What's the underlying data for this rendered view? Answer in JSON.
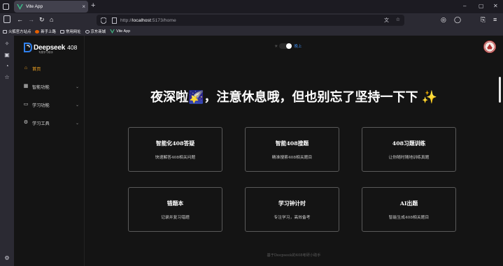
{
  "browser": {
    "tab_title": "Vite App",
    "tab_close": "×",
    "new_tab": "+",
    "url_prefix": "http://",
    "url_host": "localhost",
    "url_rest": ":5173/home",
    "window_controls": [
      "–",
      "▢",
      "✕"
    ],
    "bookmarks": [
      {
        "label": "火狐官方站点",
        "icon": "folder-icon"
      },
      {
        "label": "新手上路",
        "icon": "firefox-icon"
      },
      {
        "label": "常用网址",
        "icon": "folder-icon"
      },
      {
        "label": "京东商城",
        "icon": "globe-icon"
      },
      {
        "label": "Vite App",
        "icon": "vite-icon"
      }
    ]
  },
  "app": {
    "logo_text": "Deepseek",
    "logo_num": "408",
    "logo_sub": "专属学习助手",
    "menu": [
      {
        "label": "首页",
        "icon": "home-icon",
        "active": true,
        "has_arrow": false
      },
      {
        "label": "智能功能",
        "icon": "grid-icon",
        "active": false,
        "has_arrow": true
      },
      {
        "label": "学习功能",
        "icon": "monitor-icon",
        "active": false,
        "has_arrow": true
      },
      {
        "label": "学习工具",
        "icon": "gear-icon",
        "active": false,
        "has_arrow": true
      }
    ],
    "theme_toggle_label": "晚上",
    "headline": "夜深啦🌠，注意休息哦，但也别忘了坚持一下下 ✨",
    "cards": [
      {
        "title": "智能化408答疑",
        "desc": "快速解答408相关问题"
      },
      {
        "title": "智能408搜题",
        "desc": "精准搜索408相关题目"
      },
      {
        "title": "408习题训练",
        "desc": "让你随时随地训练真题"
      },
      {
        "title": "错题本",
        "desc": "记录并复习错题"
      },
      {
        "title": "学习钟计时",
        "desc": "专注学习，高效备考"
      },
      {
        "title": "AI出题",
        "desc": "智能生成408相关题目"
      }
    ],
    "footer": "基于Deepseek的408考研小助手"
  },
  "colors": {
    "accent": "#f5a623",
    "toggle_label": "#3d86e3",
    "app_bg": "#141414",
    "card_border": "#5a5a5a"
  }
}
